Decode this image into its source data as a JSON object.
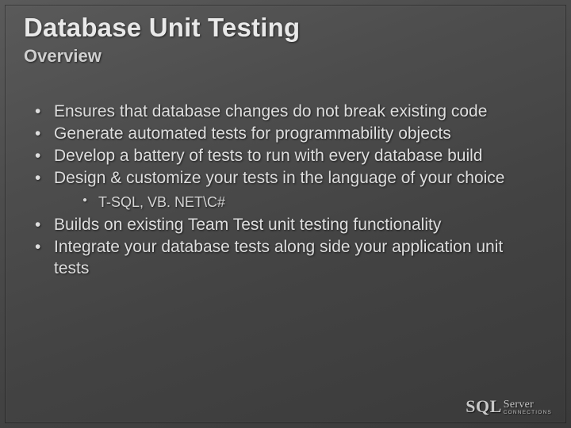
{
  "title": "Database Unit Testing",
  "subtitle": "Overview",
  "bullets": [
    {
      "text": "Ensures that database changes do not break existing code"
    },
    {
      "text": "Generate automated tests for programmability objects"
    },
    {
      "text": "Develop a battery of tests to run with every database build"
    },
    {
      "text": "Design & customize your tests in the language of your choice",
      "sub": [
        "T-SQL, VB. NET\\C#"
      ]
    },
    {
      "text": "Builds on existing Team Test unit testing functionality"
    },
    {
      "text": "Integrate your database tests along side your application unit tests"
    }
  ],
  "logo": {
    "sql": "SQL",
    "server": "Server",
    "tagline": "CONNECTIONS"
  }
}
